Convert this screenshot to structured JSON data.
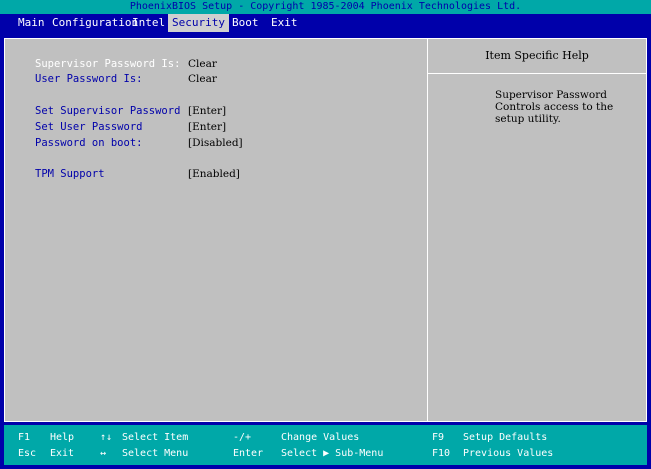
{
  "title": "PhoenixBIOS Setup - Copyright 1985-2004 Phoenix Technologies Ltd.",
  "menu": [
    {
      "label": "Main"
    },
    {
      "label": "Configuration"
    },
    {
      "label": "Intel"
    },
    {
      "label": "Security"
    },
    {
      "label": "Boot"
    },
    {
      "label": "Exit"
    }
  ],
  "active_menu": "Security",
  "settings": {
    "supervisor_status_label": "Supervisor Password Is:",
    "supervisor_status_value": "Clear",
    "user_status_label": "User Password Is:",
    "user_status_value": "Clear",
    "set_supervisor_label": "Set Supervisor Password",
    "set_supervisor_value": "[Enter]",
    "set_user_label": "Set User Password",
    "set_user_value": "[Enter]",
    "password_boot_label": "Password on boot:",
    "password_boot_value": "[Disabled]",
    "tpm_label": "TPM Support",
    "tpm_value": "[Enabled]"
  },
  "help": {
    "title": "Item Specific Help",
    "text_line1": "Supervisor Password",
    "text_line2": "Controls access to the",
    "text_line3": "setup utility."
  },
  "footer": {
    "f1_key": "F1",
    "f1_desc": "Help",
    "esc_key": "Esc",
    "esc_desc": "Exit",
    "updown_key": "↑↓",
    "updown_desc": "Select Item",
    "leftright_key": "↔",
    "leftright_desc": "Select Menu",
    "plusminus_key": "-/+",
    "plusminus_desc": "Change Values",
    "enter_key": "Enter",
    "enter_desc": "Select ▶ Sub-Menu",
    "f9_key": "F9",
    "f9_desc": "Setup Defaults",
    "f10_key": "F10",
    "f10_desc": "Previous Values"
  }
}
